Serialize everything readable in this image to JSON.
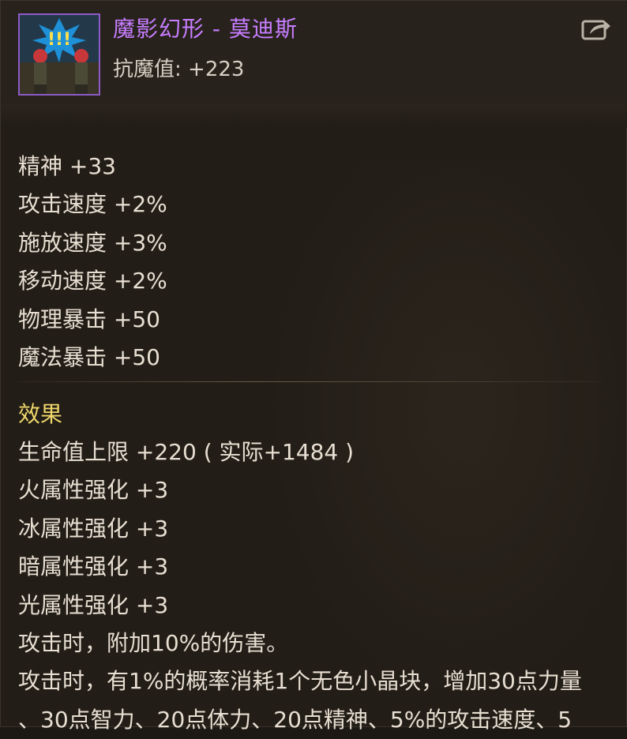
{
  "item": {
    "name": "魔影幻形 - 莫迪斯",
    "resist_label": "抗魔值:",
    "resist_value": "+223",
    "name_color": "#c77dff"
  },
  "stats": [
    "精神 +33",
    "攻击速度 +2%",
    "施放速度 +3%",
    "移动速度 +2%",
    "物理暴击 +50",
    "魔法暴击 +50"
  ],
  "effects": {
    "title": "效果",
    "title_color": "#f0d76b",
    "lines": [
      "生命值上限 +220 ( 实际+1484 )",
      "火属性强化 +3",
      "冰属性强化 +3",
      "暗属性强化 +3",
      "光属性强化 +3",
      "攻击时，附加10%的伤害。",
      "攻击时，有1%的概率消耗1个无色小晶块，增加30点力量",
      "、30点智力、20点体力、20点精神、5%的攻击速度、5"
    ]
  },
  "icons": {
    "avatar": "character-portrait-icon",
    "share": "share-export-icon"
  }
}
